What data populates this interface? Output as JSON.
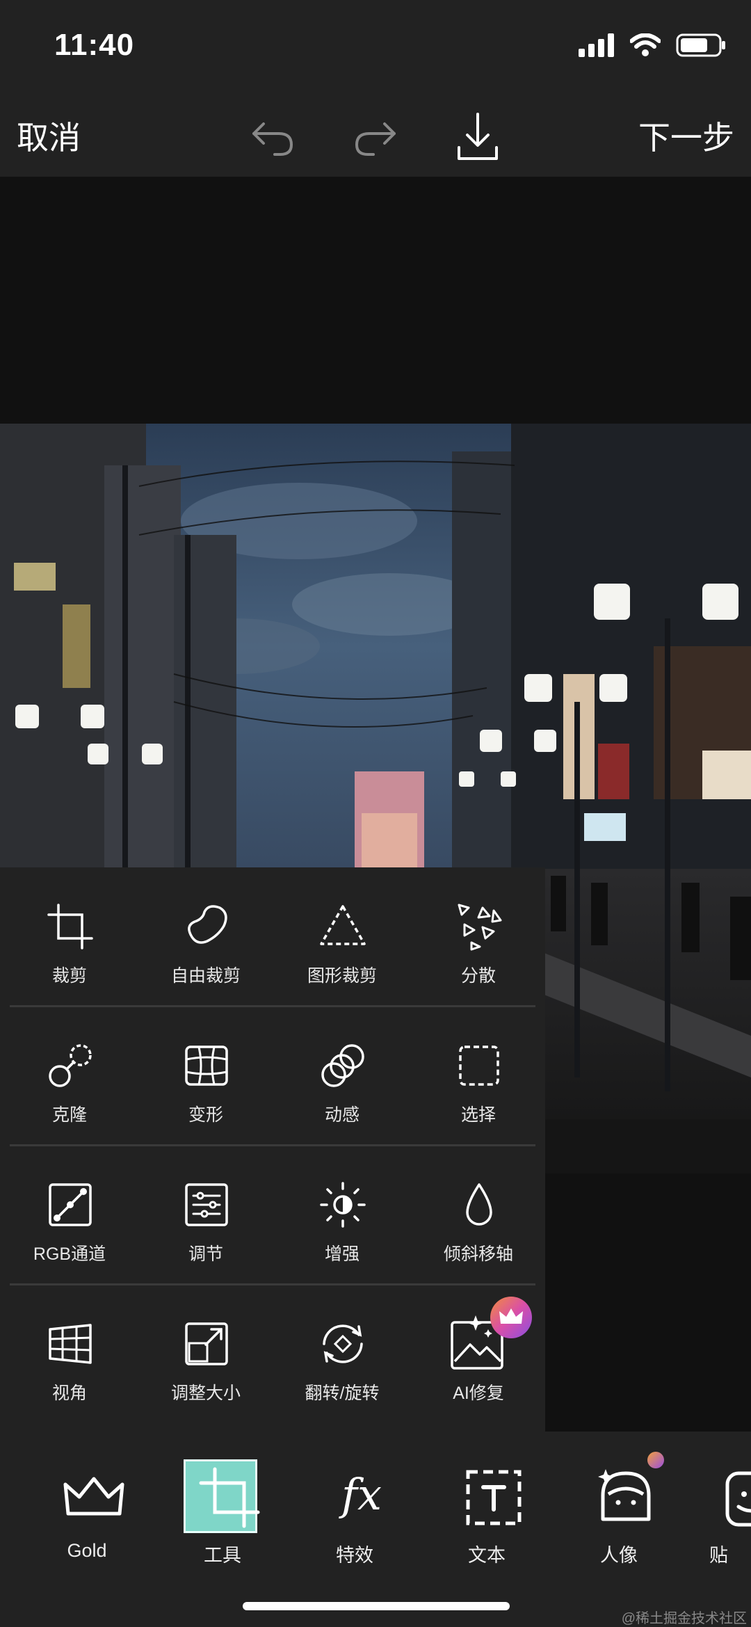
{
  "status": {
    "time": "11:40"
  },
  "topbar": {
    "cancel_label": "取消",
    "next_label": "下一步"
  },
  "tools": [
    [
      {
        "label": "裁剪",
        "icon": "crop-icon"
      },
      {
        "label": "自由裁剪",
        "icon": "free-crop-icon"
      },
      {
        "label": "图形裁剪",
        "icon": "shape-crop-icon"
      },
      {
        "label": "分散",
        "icon": "disperse-icon"
      }
    ],
    [
      {
        "label": "克隆",
        "icon": "clone-icon"
      },
      {
        "label": "变形",
        "icon": "warp-icon"
      },
      {
        "label": "动感",
        "icon": "motion-icon"
      },
      {
        "label": "选择",
        "icon": "select-icon"
      }
    ],
    [
      {
        "label": "RGB通道",
        "icon": "rgb-channel-icon"
      },
      {
        "label": "调节",
        "icon": "adjust-icon"
      },
      {
        "label": "增强",
        "icon": "enhance-icon"
      },
      {
        "label": "倾斜移轴",
        "icon": "tilt-shift-icon"
      }
    ],
    [
      {
        "label": "视角",
        "icon": "perspective-icon"
      },
      {
        "label": "调整大小",
        "icon": "resize-icon"
      },
      {
        "label": "翻转/旋转",
        "icon": "flip-rotate-icon"
      },
      {
        "label": "AI修复",
        "icon": "ai-repair-icon"
      }
    ]
  ],
  "bottom_nav": [
    {
      "label": "Gold",
      "icon": "crown-icon"
    },
    {
      "label": "工具",
      "icon": "tools-crop-icon",
      "active": true
    },
    {
      "label": "特效",
      "icon": "fx-icon"
    },
    {
      "label": "文本",
      "icon": "text-icon"
    },
    {
      "label": "人像",
      "icon": "portrait-icon"
    },
    {
      "label": "贴",
      "icon": "sticker-icon"
    }
  ],
  "watermark": "@稀土掘金技术社区",
  "colors": {
    "accent": "#7fd6c8",
    "panel": "#222222",
    "premium_badge": "#d94fa8"
  }
}
